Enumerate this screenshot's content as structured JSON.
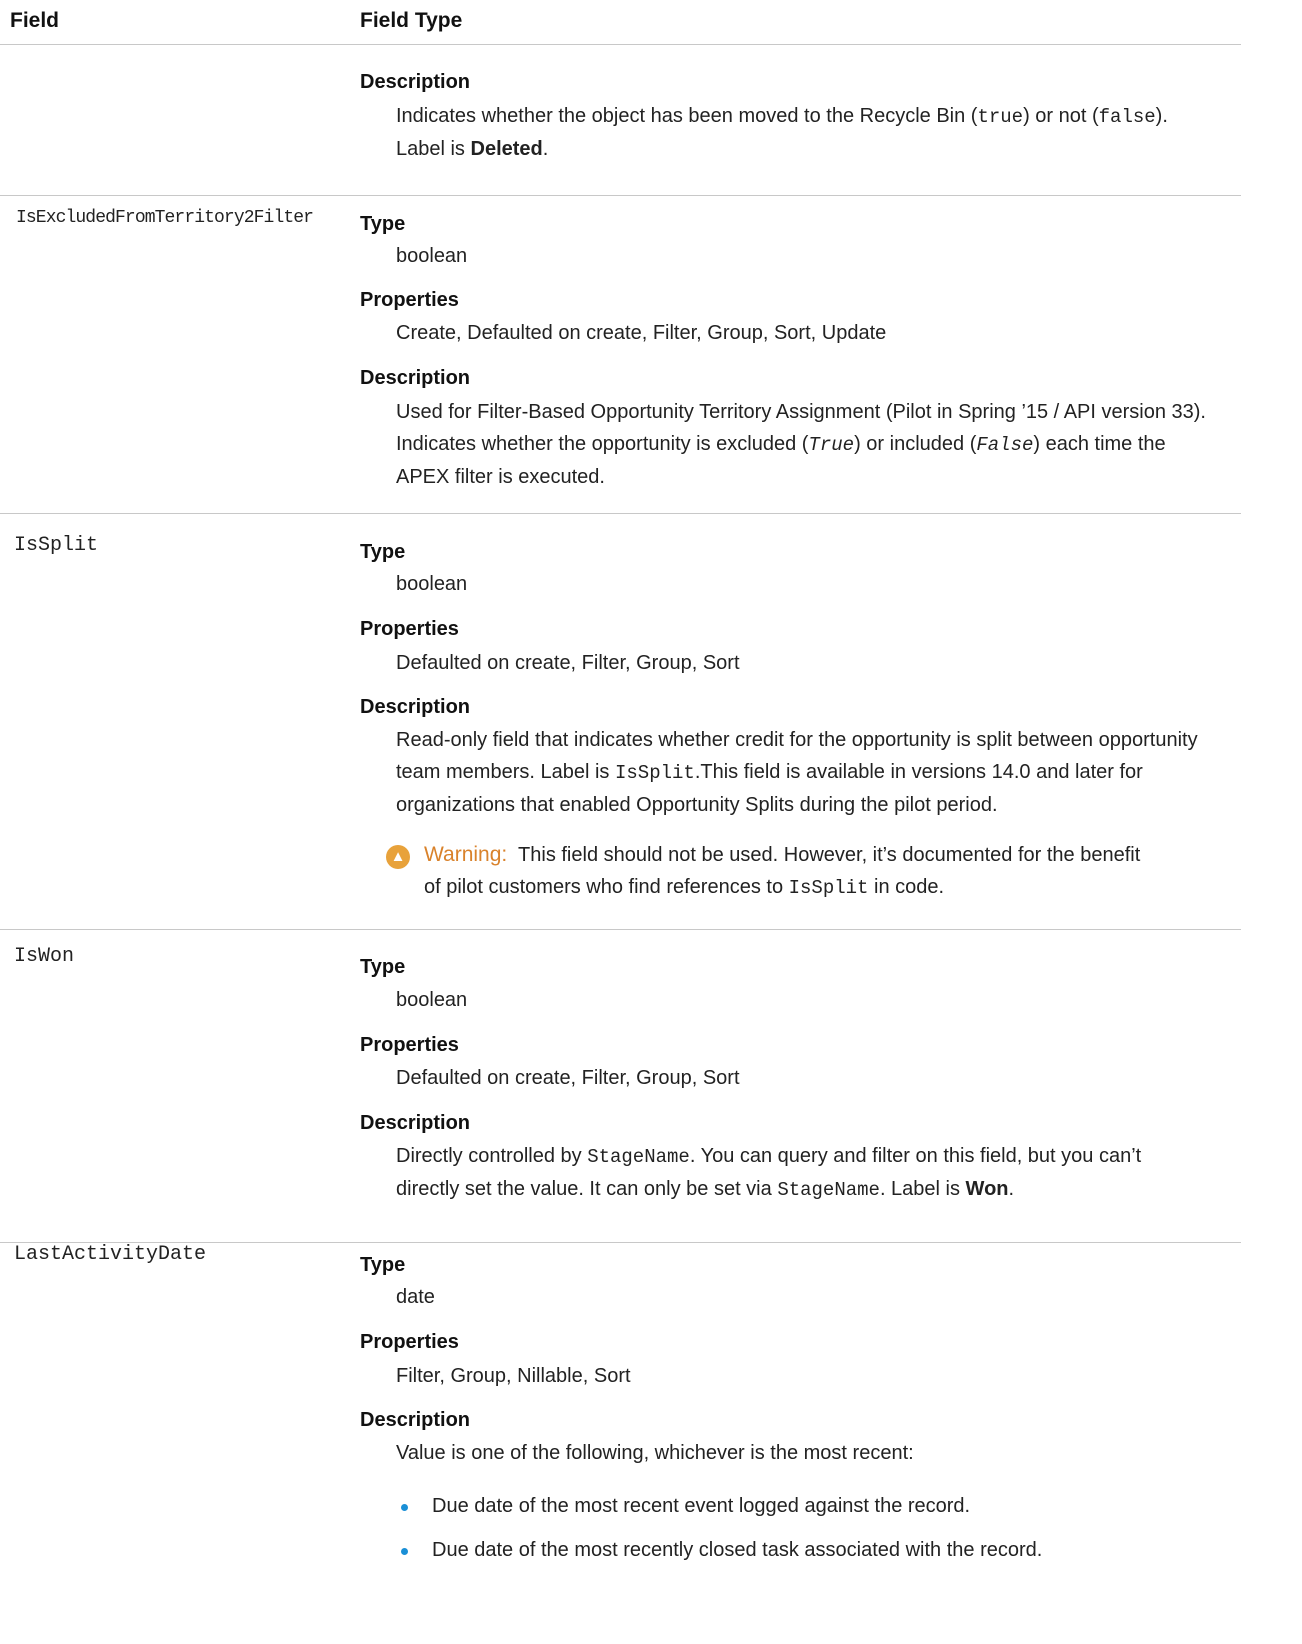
{
  "header": {
    "field": "Field",
    "field_type": "Field Type"
  },
  "rows": {
    "deleted": {
      "desc_label": "Description",
      "desc_a": "Indicates whether the object has been moved to the Recycle Bin (",
      "desc_code1": "true",
      "desc_b": ") or not (",
      "desc_code2": "false",
      "desc_c": ").",
      "desc_d": "Label is ",
      "desc_bold": "Deleted",
      "desc_e": "."
    },
    "excluded": {
      "name": "IsExcludedFromTerritory2Filter",
      "type_label": "Type",
      "type_value": "boolean",
      "props_label": "Properties",
      "props_value": "Create, Defaulted on create, Filter, Group, Sort, Update",
      "desc_label": "Description",
      "desc_line1": "Used for Filter-Based Opportunity Territory Assignment (Pilot in Spring ’15 / API version 33).",
      "desc_a": "Indicates whether the opportunity is excluded (",
      "desc_code1": "True",
      "desc_b": ") or included (",
      "desc_code2": "False",
      "desc_c": ") each time the",
      "desc_line3": "APEX filter is executed."
    },
    "issplit": {
      "name": "IsSplit",
      "type_label": "Type",
      "type_value": "boolean",
      "props_label": "Properties",
      "props_value": "Defaulted on create, Filter, Group, Sort",
      "desc_label": "Description",
      "desc_line1": "Read-only field that indicates whether credit for the opportunity is split between opportunity",
      "desc_a": "team members. Label is ",
      "desc_code": "IsSplit",
      "desc_b": ".This field is available in versions 14.0 and later for",
      "desc_line3": "organizations that enabled Opportunity Splits during the pilot period.",
      "warn_label": "Warning:",
      "warn_a": "This field should not be used. However, it’s documented for the benefit",
      "warn_b": "of pilot customers who find references to ",
      "warn_code": "IsSplit",
      "warn_c": " in code."
    },
    "iswon": {
      "name": "IsWon",
      "type_label": "Type",
      "type_value": "boolean",
      "props_label": "Properties",
      "props_value": "Defaulted on create, Filter, Group, Sort",
      "desc_label": "Description",
      "desc_a": "Directly controlled by ",
      "desc_code1": "StageName",
      "desc_b": ". You can query and filter on this field, but you can’t",
      "desc_c": "directly set the value. It can only be set via ",
      "desc_code2": "StageName",
      "desc_d": ". Label is ",
      "desc_bold": "Won",
      "desc_e": "."
    },
    "lastactivity": {
      "name": "LastActivityDate",
      "type_label": "Type",
      "type_value": "date",
      "props_label": "Properties",
      "props_value": "Filter, Group, Nillable, Sort",
      "desc_label": "Description",
      "desc_intro": "Value is one of the following, whichever is the most recent:",
      "bullets": [
        "Due date of the most recent event logged against the record.",
        "Due date of the most recently closed task associated with the record."
      ]
    }
  }
}
